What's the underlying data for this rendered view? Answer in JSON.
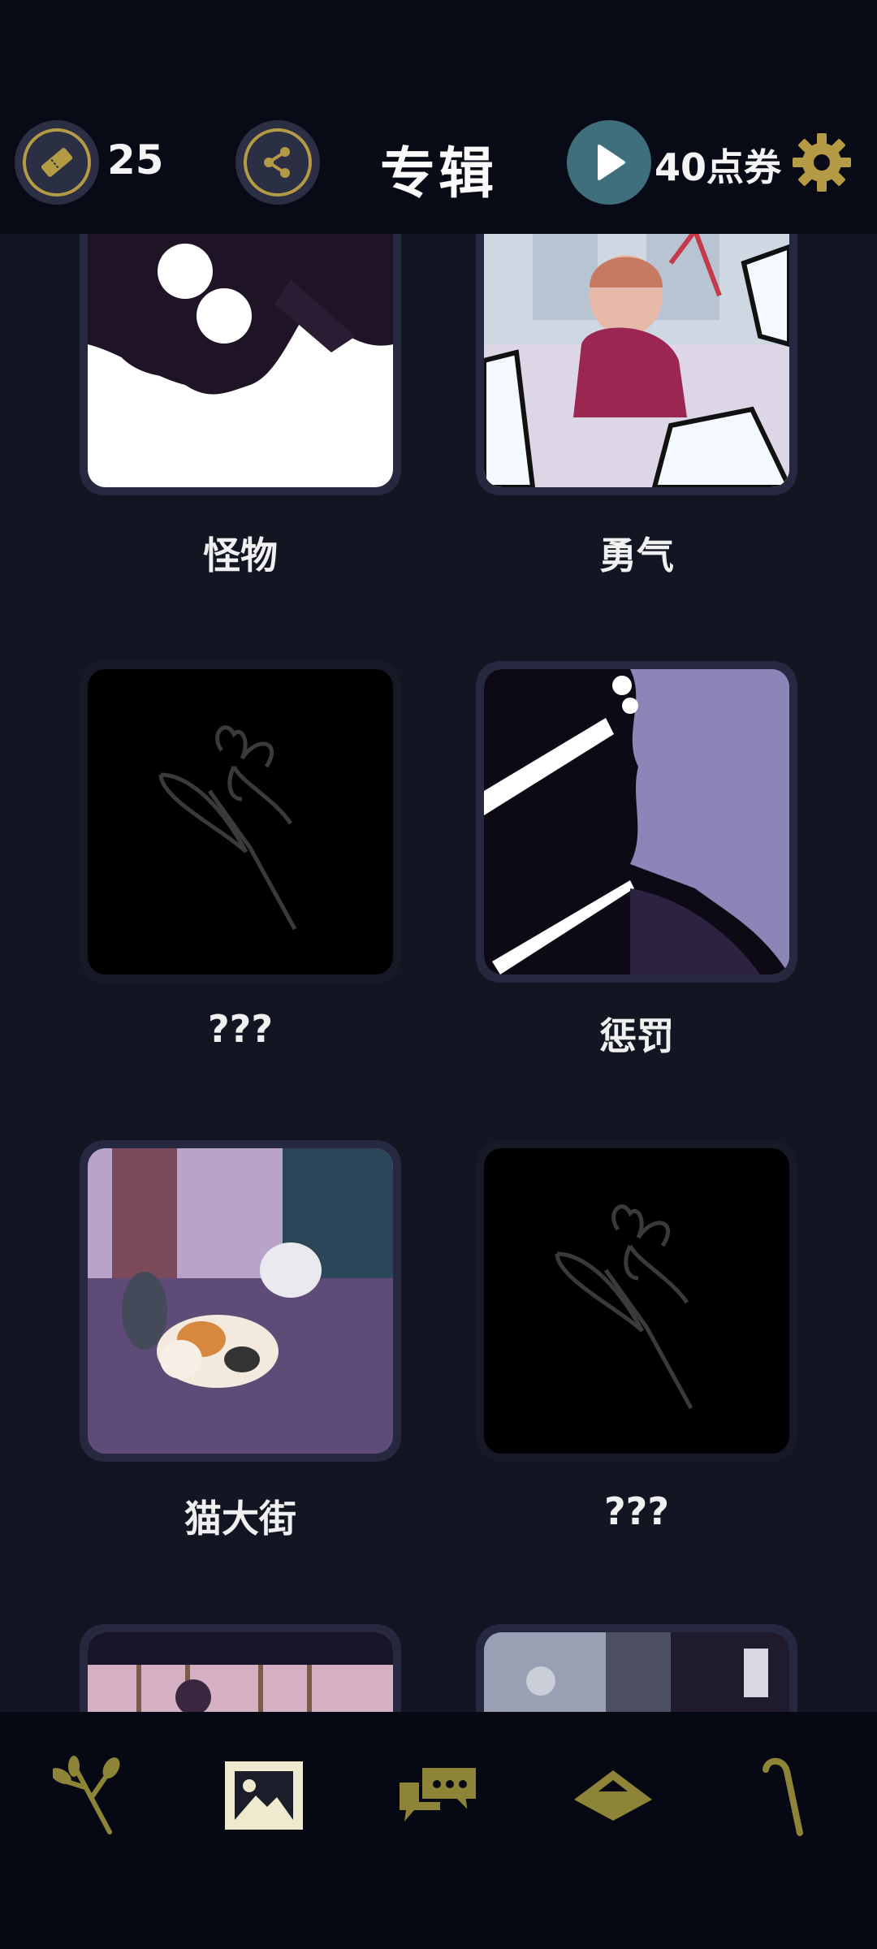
{
  "header": {
    "ticket_count": "25",
    "title": "专辑",
    "coupon_label": "40点券"
  },
  "albums": [
    {
      "label": "怪物",
      "state": "unlocked"
    },
    {
      "label": "勇气",
      "state": "unlocked"
    },
    {
      "label": "???",
      "state": "locked"
    },
    {
      "label": "惩罚",
      "state": "unlocked"
    },
    {
      "label": "猫大街",
      "state": "unlocked"
    },
    {
      "label": "???",
      "state": "locked"
    },
    {
      "label": "",
      "state": "unlocked"
    },
    {
      "label": "",
      "state": "unlocked"
    }
  ],
  "nav": {
    "items": [
      {
        "icon": "plant-icon",
        "active": false
      },
      {
        "icon": "gallery-icon",
        "active": true
      },
      {
        "icon": "chat-icon",
        "active": false
      },
      {
        "icon": "hat-icon",
        "active": false
      },
      {
        "icon": "cane-icon",
        "active": false
      }
    ]
  },
  "colors": {
    "accent_gold": "#b49a45",
    "background": "#121522",
    "topbar": "#080b16",
    "play_button": "#3f6f7d"
  }
}
